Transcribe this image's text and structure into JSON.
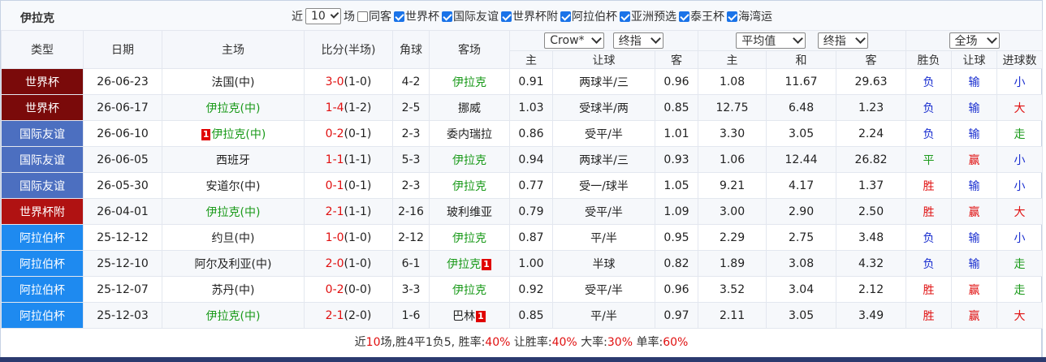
{
  "title": "伊拉克",
  "filters": {
    "near_label": "近",
    "count_value": "10",
    "games_label": "场",
    "same_host_label": "同客",
    "options": [
      {
        "label": "世界杯",
        "checked": true
      },
      {
        "label": "国际友谊",
        "checked": true
      },
      {
        "label": "世界杯附",
        "checked": true
      },
      {
        "label": "阿拉伯杯",
        "checked": true
      },
      {
        "label": "亚洲预选",
        "checked": true
      },
      {
        "label": "泰王杯",
        "checked": true
      },
      {
        "label": "海湾运",
        "checked": true
      }
    ]
  },
  "header": {
    "type": "类型",
    "date": "日期",
    "home": "主场",
    "score": "比分(半场)",
    "corner": "角球",
    "away": "客场",
    "company_select": "Crow*",
    "handicap_select": "终指",
    "avg_select": "平均值",
    "euro_select": "终指",
    "scope_select": "全场",
    "sub": [
      "主",
      "让球",
      "客",
      "主",
      "和",
      "客",
      "胜负",
      "让球",
      "进球数"
    ]
  },
  "colors": {
    "world_cup": "#7a0a0a",
    "friendly": "#4c6fc0",
    "wc_qual": "#b01212",
    "arab_cup": "#1e8af0",
    "highlight_green": "#1a9a1a",
    "highlight_red": "#e01010",
    "loss_blue": "#1a2fd0"
  },
  "rows": [
    {
      "type": "世界杯",
      "date": "26-06-23",
      "home": "法国(中)",
      "home_badge": "",
      "score": "3-0",
      "half": "(1-0)",
      "corner": "4-2",
      "away": "伊拉克",
      "away_badge": "",
      "o1": "0.91",
      "hcap": "两球半/三",
      "o2": "0.96",
      "e1": "1.08",
      "e2": "11.67",
      "e3": "29.63",
      "wl": "负",
      "hres": "输",
      "goals": "小"
    },
    {
      "type": "世界杯",
      "date": "26-06-17",
      "home": "伊拉克(中)",
      "home_badge": "",
      "score": "1-4",
      "half": "(1-2)",
      "corner": "2-5",
      "away": "挪威",
      "away_badge": "",
      "o1": "1.03",
      "hcap": "受球半/两",
      "o2": "0.85",
      "e1": "12.75",
      "e2": "6.48",
      "e3": "1.23",
      "wl": "负",
      "hres": "输",
      "goals": "大"
    },
    {
      "type": "国际友谊",
      "date": "26-06-10",
      "home": "伊拉克(中)",
      "home_badge": "1",
      "score": "0-2",
      "half": "(0-1)",
      "corner": "2-3",
      "away": "委内瑞拉",
      "away_badge": "",
      "o1": "0.86",
      "hcap": "受平/半",
      "o2": "1.01",
      "e1": "3.30",
      "e2": "3.05",
      "e3": "2.24",
      "wl": "负",
      "hres": "输",
      "goals": "走"
    },
    {
      "type": "国际友谊",
      "date": "26-06-05",
      "home": "西班牙",
      "home_badge": "",
      "score": "1-1",
      "half": "(1-1)",
      "corner": "5-3",
      "away": "伊拉克",
      "away_badge": "",
      "o1": "0.94",
      "hcap": "两球半/三",
      "o2": "0.93",
      "e1": "1.06",
      "e2": "12.44",
      "e3": "26.82",
      "wl": "平",
      "hres": "赢",
      "goals": "小"
    },
    {
      "type": "国际友谊",
      "date": "26-05-30",
      "home": "安道尔(中)",
      "home_badge": "",
      "score": "0-1",
      "half": "(0-1)",
      "corner": "2-3",
      "away": "伊拉克",
      "away_badge": "",
      "o1": "0.77",
      "hcap": "受一/球半",
      "o2": "1.05",
      "e1": "9.21",
      "e2": "4.17",
      "e3": "1.37",
      "wl": "胜",
      "hres": "输",
      "goals": "小"
    },
    {
      "type": "世界杯附",
      "date": "26-04-01",
      "home": "伊拉克(中)",
      "home_badge": "",
      "score": "2-1",
      "half": "(1-1)",
      "corner": "2-16",
      "away": "玻利维亚",
      "away_badge": "",
      "o1": "0.79",
      "hcap": "受平/半",
      "o2": "1.09",
      "e1": "3.00",
      "e2": "2.90",
      "e3": "2.50",
      "wl": "胜",
      "hres": "赢",
      "goals": "大"
    },
    {
      "type": "阿拉伯杯",
      "date": "25-12-12",
      "home": "约旦(中)",
      "home_badge": "",
      "score": "1-0",
      "half": "(1-0)",
      "corner": "2-12",
      "away": "伊拉克",
      "away_badge": "",
      "o1": "0.87",
      "hcap": "平/半",
      "o2": "0.95",
      "e1": "2.29",
      "e2": "2.75",
      "e3": "3.48",
      "wl": "负",
      "hres": "输",
      "goals": "小"
    },
    {
      "type": "阿拉伯杯",
      "date": "25-12-10",
      "home": "阿尔及利亚(中)",
      "home_badge": "",
      "score": "2-0",
      "half": "(1-0)",
      "corner": "6-1",
      "away": "伊拉克",
      "away_badge": "1",
      "o1": "1.00",
      "hcap": "半球",
      "o2": "0.82",
      "e1": "1.89",
      "e2": "3.08",
      "e3": "4.32",
      "wl": "负",
      "hres": "输",
      "goals": "走"
    },
    {
      "type": "阿拉伯杯",
      "date": "25-12-07",
      "home": "苏丹(中)",
      "home_badge": "",
      "score": "0-2",
      "half": "(0-0)",
      "corner": "3-3",
      "away": "伊拉克",
      "away_badge": "",
      "o1": "0.92",
      "hcap": "受平/半",
      "o2": "0.96",
      "e1": "3.52",
      "e2": "3.04",
      "e3": "2.12",
      "wl": "胜",
      "hres": "赢",
      "goals": "走"
    },
    {
      "type": "阿拉伯杯",
      "date": "25-12-03",
      "home": "伊拉克(中)",
      "home_badge": "",
      "score": "2-1",
      "half": "(2-0)",
      "corner": "1-6",
      "away": "巴林",
      "away_badge": "1",
      "o1": "0.85",
      "hcap": "平/半",
      "o2": "0.97",
      "e1": "2.11",
      "e2": "3.05",
      "e3": "3.49",
      "wl": "胜",
      "hres": "赢",
      "goals": "大"
    }
  ],
  "summary": {
    "prefix": "近",
    "count": "10",
    "mid": "场,胜4平1负5, 胜率:",
    "win_rate": "40%",
    "hcap_label": " 让胜率:",
    "hcap_rate": "40%",
    "big_label": " 大率:",
    "big_rate": "30%",
    "odd_label": " 单率:",
    "odd_rate": "60%"
  }
}
